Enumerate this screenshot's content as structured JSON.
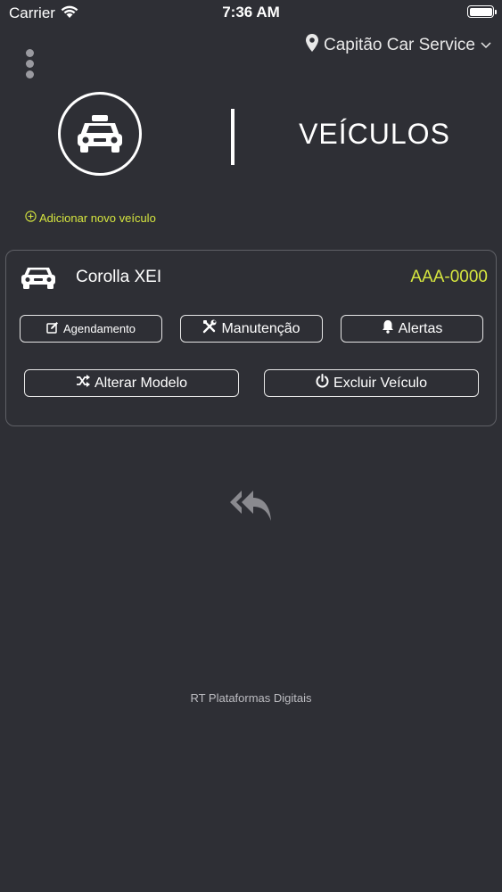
{
  "status_bar": {
    "carrier": "Carrier",
    "time": "7:36 AM"
  },
  "header": {
    "location_name": "Capitão Car Service",
    "location_icon": "map-pin-icon",
    "title": "VEÍCULOS",
    "icon": "taxi-icon"
  },
  "add_vehicle_label": "Adicionar novo veículo",
  "vehicle": {
    "model": "Corolla XEI",
    "plate": "AAA-0000",
    "actions": {
      "scheduling": "Agendamento",
      "maintenance": "Manutenção",
      "alerts": "Alertas",
      "change_model": "Alterar Modelo",
      "delete_vehicle": "Excluir Veículo"
    }
  },
  "footer": "RT Plataformas Digitais",
  "colors": {
    "background": "#2e2f35",
    "accent": "#d6e63f",
    "text": "#ffffff"
  }
}
